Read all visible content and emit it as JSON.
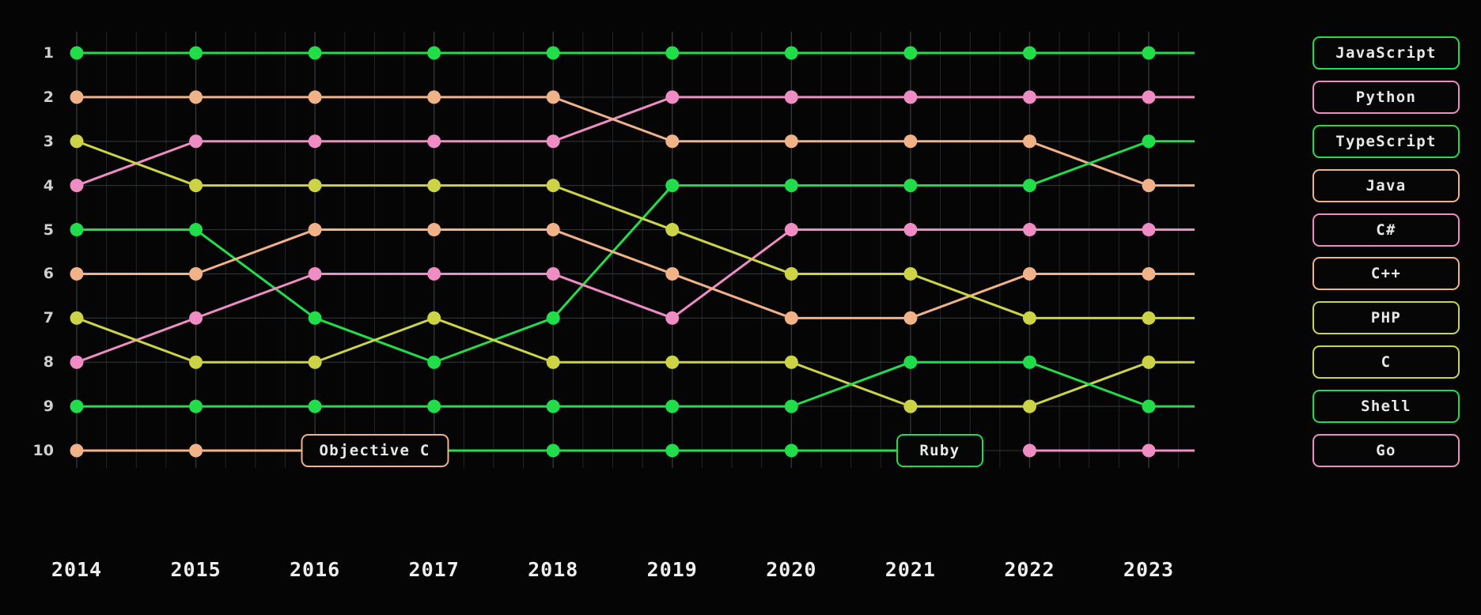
{
  "background": "#050505",
  "panel": "#000000",
  "grid_color": "#3a3f44",
  "axis": {
    "x_labels": [
      "2014",
      "2015",
      "2016",
      "2017",
      "2018",
      "2019",
      "2020",
      "2021",
      "2022",
      "2023"
    ],
    "y_labels": [
      "1",
      "2",
      "3",
      "4",
      "5",
      "6",
      "7",
      "8",
      "9",
      "10"
    ]
  },
  "palette": {
    "green": "#22dd4a",
    "peach": "#f2b288",
    "yellow": "#ccd446",
    "pink": "#f08cc4"
  },
  "right_labels": [
    {
      "text": "JavaScript",
      "color": "#22dd4a",
      "rank": 1
    },
    {
      "text": "Python",
      "color": "#f08cc4",
      "rank": 2
    },
    {
      "text": "TypeScript",
      "color": "#22dd4a",
      "rank": 3
    },
    {
      "text": "Java",
      "color": "#f2b288",
      "rank": 4
    },
    {
      "text": "C#",
      "color": "#f08cc4",
      "rank": 5
    },
    {
      "text": "C++",
      "color": "#f2b288",
      "rank": 6
    },
    {
      "text": "PHP",
      "color": "#ccd446",
      "rank": 7
    },
    {
      "text": "C",
      "color": "#ccd446",
      "rank": 8
    },
    {
      "text": "Shell",
      "color": "#22dd4a",
      "rank": 9
    },
    {
      "text": "Go",
      "color": "#f08cc4",
      "rank": 10
    }
  ],
  "inline_labels": [
    {
      "text": "Objective C",
      "color": "#f2b288",
      "year": "2016",
      "rank": 10
    },
    {
      "text": "Ruby",
      "color": "#22dd4a",
      "year": "2021",
      "rank": 10
    }
  ],
  "chart_data": {
    "type": "line",
    "subtype": "bump",
    "title": "",
    "xlabel": "",
    "ylabel": "",
    "x": [
      "2014",
      "2015",
      "2016",
      "2017",
      "2018",
      "2019",
      "2020",
      "2021",
      "2022",
      "2023"
    ],
    "ylim": [
      1,
      10
    ],
    "y_inverted": true,
    "grid": true,
    "legend_position": "right-inline-labels",
    "series": [
      {
        "name": "JavaScript",
        "color": "#22dd4a",
        "values": [
          1,
          1,
          1,
          1,
          1,
          1,
          1,
          1,
          1,
          1
        ]
      },
      {
        "name": "Python",
        "color": "#f08cc4",
        "values": [
          4,
          3,
          3,
          3,
          3,
          2,
          2,
          2,
          2,
          2
        ]
      },
      {
        "name": "Java",
        "color": "#f2b288",
        "values": [
          2,
          2,
          2,
          2,
          2,
          3,
          3,
          3,
          3,
          4
        ]
      },
      {
        "name": "TypeScript",
        "color": "#22dd4a",
        "values": [
          5,
          5,
          7,
          8,
          7,
          4,
          4,
          4,
          4,
          3
        ]
      },
      {
        "name": "C#",
        "color": "#f08cc4",
        "values": [
          8,
          7,
          6,
          6,
          6,
          7,
          5,
          5,
          5,
          5
        ]
      },
      {
        "name": "C++",
        "color": "#f2b288",
        "values": [
          6,
          6,
          5,
          5,
          5,
          6,
          7,
          7,
          6,
          6
        ]
      },
      {
        "name": "PHP",
        "color": "#ccd446",
        "values": [
          3,
          4,
          4,
          4,
          4,
          5,
          6,
          6,
          7,
          7
        ]
      },
      {
        "name": "C",
        "color": "#ccd446",
        "values": [
          7,
          8,
          8,
          7,
          8,
          8,
          8,
          9,
          9,
          8
        ]
      },
      {
        "name": "Shell",
        "color": "#22dd4a",
        "values": [
          9,
          9,
          9,
          9,
          9,
          9,
          9,
          8,
          8,
          9
        ]
      },
      {
        "name": "Go",
        "color": "#f08cc4",
        "values": [
          null,
          null,
          null,
          null,
          null,
          null,
          null,
          null,
          10,
          10
        ]
      },
      {
        "name": "Objective C",
        "color": "#f2b288",
        "values": [
          10,
          10,
          10,
          null,
          null,
          null,
          null,
          null,
          null,
          null
        ]
      },
      {
        "name": "Ruby",
        "color": "#22dd4a",
        "values": [
          null,
          null,
          null,
          10,
          10,
          10,
          10,
          10,
          null,
          null
        ]
      }
    ]
  }
}
